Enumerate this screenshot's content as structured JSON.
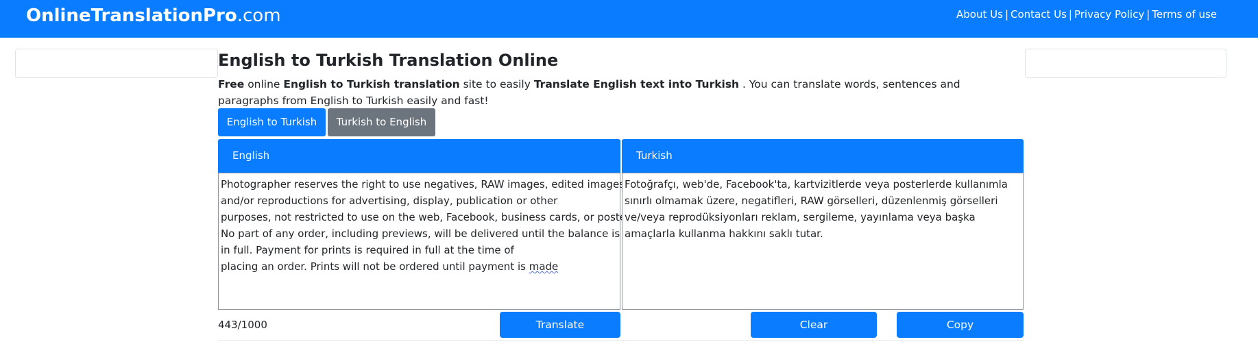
{
  "header": {
    "brand_bold": "OnlineTranslationPro",
    "brand_suffix": ".com",
    "links": [
      "About Us",
      "Contact Us",
      "Privacy Policy",
      "Terms of use"
    ],
    "separator": "|"
  },
  "main": {
    "title": "English to Turkish Translation Online",
    "intro": {
      "p1": "Free",
      "p2": " online ",
      "p3": "English to Turkish translation",
      "p4": " site to easily ",
      "p5": "Translate English text into Turkish",
      "p6": " . You can translate words, sentences and paragraphs from English to Turkish easily and fast!"
    },
    "tabs": [
      {
        "label": "English to Turkish",
        "active": true
      },
      {
        "label": "Turkish to English",
        "active": false
      }
    ],
    "source": {
      "header": "English",
      "lines": [
        "Photographer reserves the right to use negatives, RAW images, edited images",
        "and/or reproductions for advertising, display, publication or other",
        "purposes, not restricted to use on the web, Facebook, business cards, or posters.",
        "No part of any order, including previews, will be delivered until the balance is paid",
        "in full. Payment for prints is required in full at the time of"
      ],
      "last_line_prefix": "placing an order. Prints will not be ordered until payment is ",
      "last_line_flagged_word": "made",
      "char_count": "443/1000"
    },
    "target": {
      "header": "Turkish",
      "text": "Fotoğrafçı, web'de, Facebook'ta, kartvizitlerde veya posterlerde kullanımla sınırlı olmamak üzere, negatifleri, RAW görselleri, düzenlenmiş görselleri ve/veya reprodüksiyonları reklam, sergileme, yayınlama veya başka amaçlarla kullanma hakkını saklı tutar."
    },
    "buttons": {
      "translate": "Translate",
      "clear": "Clear",
      "copy": "Copy"
    }
  },
  "colors": {
    "primary": "#0a7cff",
    "secondary": "#6c757d"
  }
}
